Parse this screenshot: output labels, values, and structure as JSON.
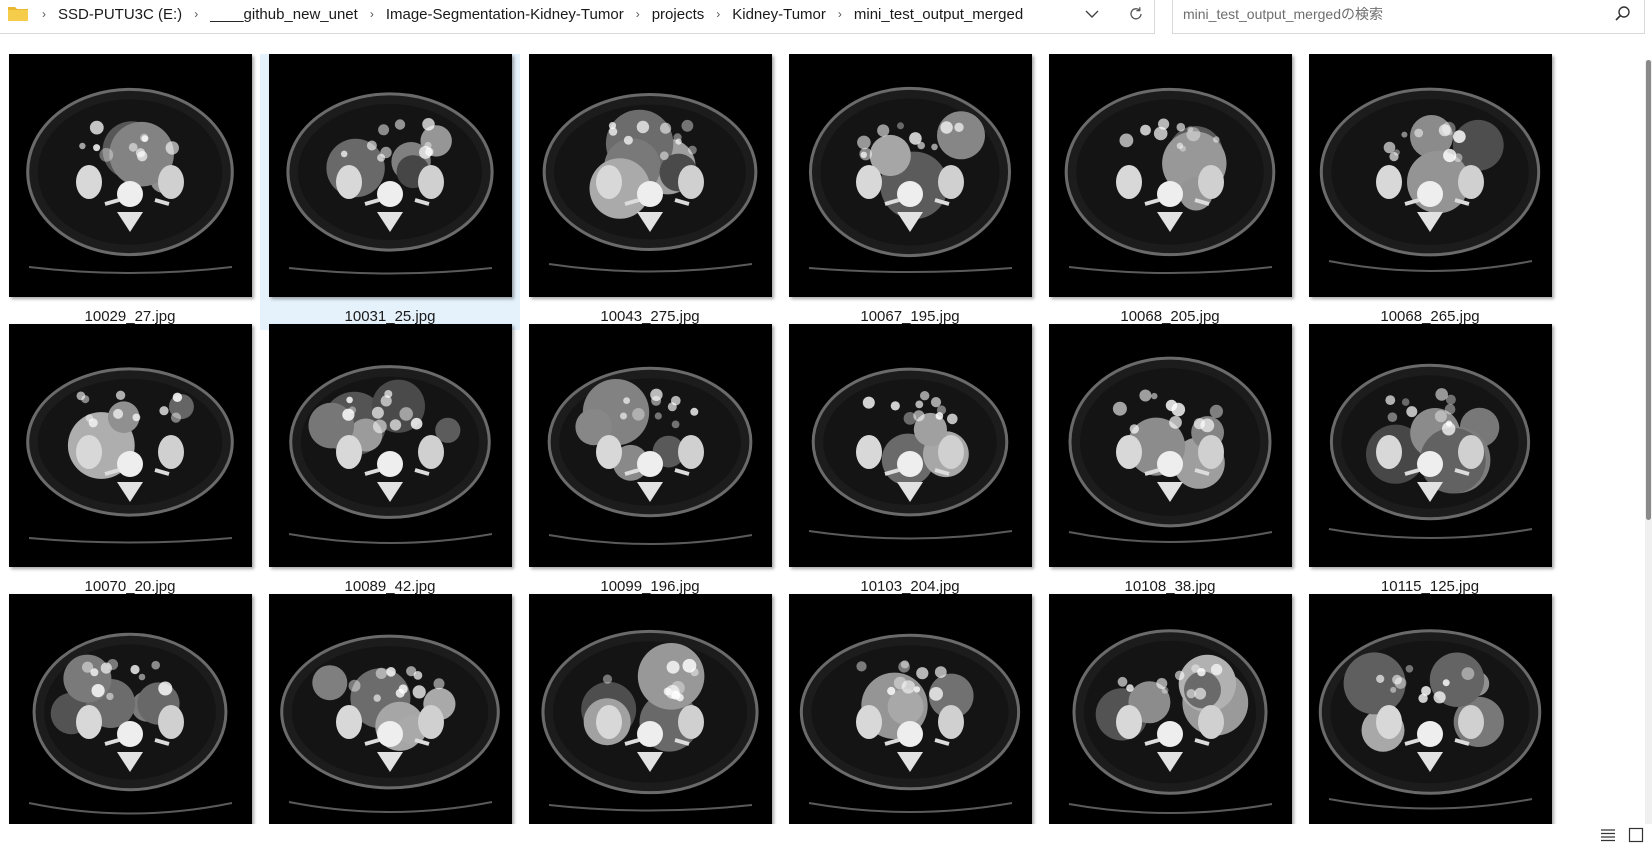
{
  "breadcrumb": {
    "items": [
      "SSD-PUTU3C (E:)",
      "____github_new_unet",
      "Image-Segmentation-Kidney-Tumor",
      "projects",
      "Kidney-Tumor",
      "mini_test_output_merged"
    ]
  },
  "search": {
    "placeholder": "mini_test_output_mergedの検索"
  },
  "files": [
    {
      "name": "10029_27.jpg",
      "selected": false
    },
    {
      "name": "10031_25.jpg",
      "selected": true
    },
    {
      "name": "10043_275.jpg",
      "selected": false
    },
    {
      "name": "10067_195.jpg",
      "selected": false
    },
    {
      "name": "10068_205.jpg",
      "selected": false
    },
    {
      "name": "10068_265.jpg",
      "selected": false
    },
    {
      "name": "10070_20.jpg",
      "selected": false
    },
    {
      "name": "10089_42.jpg",
      "selected": false
    },
    {
      "name": "10099_196.jpg",
      "selected": false
    },
    {
      "name": "10103_204.jpg",
      "selected": false
    },
    {
      "name": "10108_38.jpg",
      "selected": false
    },
    {
      "name": "10115_125.jpg",
      "selected": false
    },
    {
      "name": "",
      "selected": false
    },
    {
      "name": "",
      "selected": false
    },
    {
      "name": "",
      "selected": false
    },
    {
      "name": "",
      "selected": false
    },
    {
      "name": "",
      "selected": false
    },
    {
      "name": "",
      "selected": false
    }
  ],
  "icons": {
    "folder": "folder-icon",
    "dropdown": "chevron-down-icon",
    "refresh": "refresh-icon",
    "search": "search-icon",
    "details_view": "details-view-icon",
    "large_icons_view": "large-icons-view-icon"
  },
  "colors": {
    "selection": "#e5f1fb",
    "folder": "#e8b931"
  }
}
